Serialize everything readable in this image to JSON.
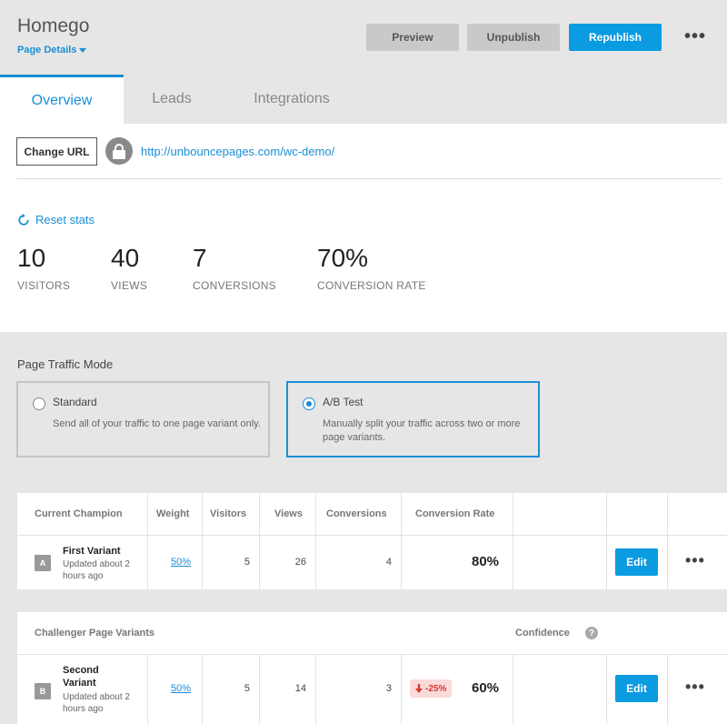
{
  "header": {
    "title": "Homego",
    "page_details": "Page Details",
    "preview": "Preview",
    "unpublish": "Unpublish",
    "republish": "Republish",
    "more": "•••"
  },
  "tabs": [
    {
      "label": "Overview",
      "active": true
    },
    {
      "label": "Leads",
      "active": false
    },
    {
      "label": "Integrations",
      "active": false
    }
  ],
  "url_bar": {
    "change_url": "Change URL",
    "url": "http://unbouncepages.com/wc-demo/"
  },
  "stats": {
    "reset": "Reset stats",
    "items": [
      {
        "value": "10",
        "label": "VISITORS"
      },
      {
        "value": "40",
        "label": "VIEWS"
      },
      {
        "value": "7",
        "label": "CONVERSIONS"
      },
      {
        "value": "70%",
        "label": "CONVERSION RATE"
      }
    ]
  },
  "traffic": {
    "title": "Page Traffic Mode",
    "modes": [
      {
        "title": "Standard",
        "desc": "Send all of your traffic to one page variant only.",
        "selected": false
      },
      {
        "title": "A/B Test",
        "desc": "Manually split your traffic across two or more page variants.",
        "selected": true
      }
    ]
  },
  "champion_table": {
    "headers": [
      "Current Champion",
      "Weight",
      "Visitors",
      "Views",
      "Conversions",
      "Conversion Rate"
    ],
    "row": {
      "badge": "A",
      "name": "First Variant",
      "updated_1": "Updated about 2",
      "updated_2": "hours ago",
      "weight": "50%",
      "visitors": "5",
      "views": "26",
      "conversions": "4",
      "rate": "80%",
      "edit": "Edit",
      "more": "•••"
    }
  },
  "challenger_table": {
    "header": "Challenger Page Variants",
    "confidence": "Confidence",
    "help": "?",
    "row": {
      "badge": "B",
      "name_1": "Second",
      "name_2": "Variant",
      "updated_1": "Updated about 2",
      "updated_2": "hours ago",
      "weight": "50%",
      "visitors": "5",
      "views": "14",
      "conversions": "3",
      "delta": "-25%",
      "rate": "60%",
      "edit": "Edit",
      "more": "•••"
    }
  },
  "colors": {
    "accent": "#0a9be0",
    "link": "#1a8fd6",
    "negative": "#d33"
  }
}
